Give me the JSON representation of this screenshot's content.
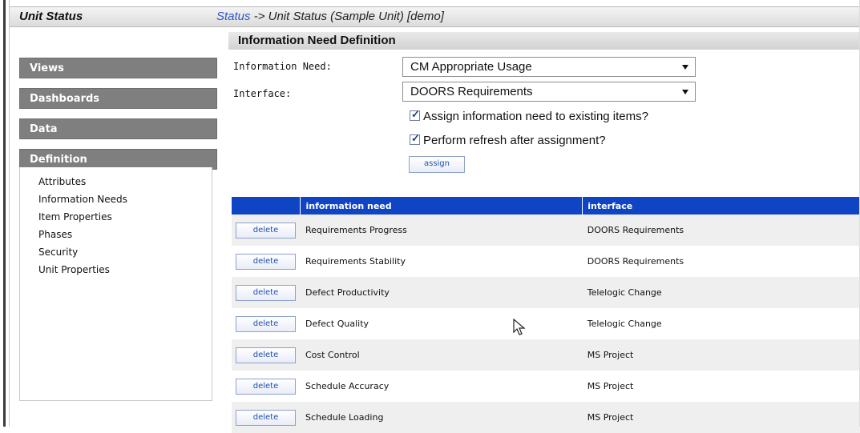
{
  "header": {
    "title": "Unit Status",
    "breadcrumb_link": "Status",
    "breadcrumb_rest": " -> Unit Status (Sample Unit) [demo]"
  },
  "section": {
    "title": "Information Need Definition"
  },
  "sidebar": {
    "headers": [
      "Views",
      "Dashboards",
      "Data",
      "Definition"
    ],
    "items": [
      "Attributes",
      "Information Needs",
      "Item Properties",
      "Phases",
      "Security",
      "Unit Properties"
    ]
  },
  "form": {
    "information_need_label": "Information Need:",
    "information_need_value": "CM Appropriate Usage",
    "interface_label": "Interface:",
    "interface_value": "DOORS Requirements",
    "assign_existing_label": "Assign information need to existing items?",
    "refresh_label": "Perform refresh after assignment?",
    "assign_button": "assign"
  },
  "table": {
    "columns": [
      "",
      "information need",
      "interface"
    ],
    "delete_label": "delete",
    "rows": [
      {
        "need": "Requirements Progress",
        "interface": "DOORS Requirements"
      },
      {
        "need": "Requirements Stability",
        "interface": "DOORS Requirements"
      },
      {
        "need": "Defect Productivity",
        "interface": "Telelogic Change"
      },
      {
        "need": "Defect Quality",
        "interface": "Telelogic Change"
      },
      {
        "need": "Cost Control",
        "interface": "MS Project"
      },
      {
        "need": "Schedule Accuracy",
        "interface": "MS Project"
      },
      {
        "need": "Schedule Loading",
        "interface": "MS Project"
      }
    ]
  },
  "colors": {
    "table_header": "#0f45c4",
    "nav_header": "#7f7f7f",
    "link": "#2f57c8"
  }
}
